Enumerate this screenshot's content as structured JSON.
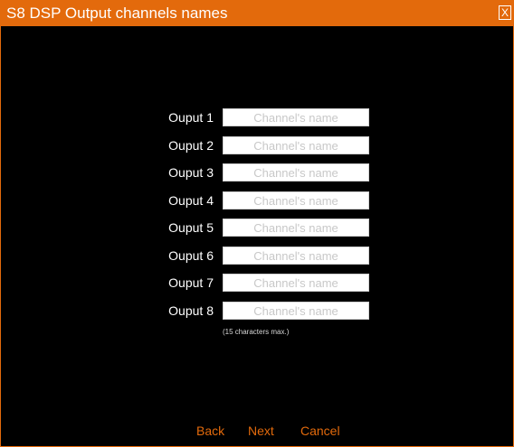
{
  "window": {
    "title": "S8 DSP Output channels names",
    "close_label": "X"
  },
  "outputs": [
    {
      "label": "Ouput 1",
      "value": "",
      "placeholder": "Channel's name"
    },
    {
      "label": "Ouput 2",
      "value": "",
      "placeholder": "Channel's name"
    },
    {
      "label": "Ouput 3",
      "value": "",
      "placeholder": "Channel's name"
    },
    {
      "label": "Ouput 4",
      "value": "",
      "placeholder": "Channel's name"
    },
    {
      "label": "Ouput 5",
      "value": "",
      "placeholder": "Channel's name"
    },
    {
      "label": "Ouput 6",
      "value": "",
      "placeholder": "Channel's name"
    },
    {
      "label": "Ouput 7",
      "value": "",
      "placeholder": "Channel's name"
    },
    {
      "label": "Ouput 8",
      "value": "",
      "placeholder": "Channel's name"
    }
  ],
  "hint": "(15 characters max.)",
  "buttons": {
    "back": "Back",
    "next": "Next",
    "cancel": "Cancel"
  },
  "colors": {
    "accent": "#e36a0c",
    "background": "#000000",
    "label_text": "#ffffff",
    "placeholder_text": "#c8c8c8"
  }
}
